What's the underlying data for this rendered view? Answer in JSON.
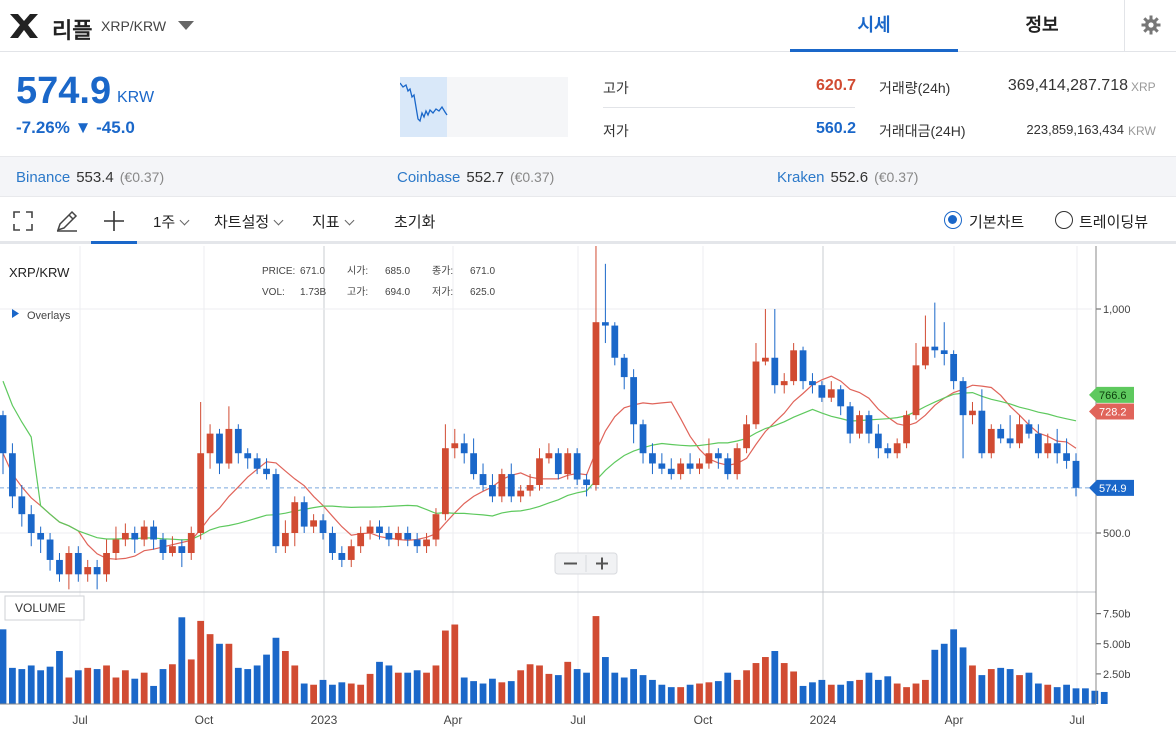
{
  "header": {
    "coin_name": "리플",
    "pair": "XRP/KRW",
    "tabs": [
      {
        "label": "시세",
        "active": true
      },
      {
        "label": "정보",
        "active": false
      }
    ]
  },
  "ticker": {
    "price": "574.9",
    "unit": "KRW",
    "change": "-7.26% ▼ -45.0",
    "high_label": "고가",
    "high_value": "620.7",
    "low_label": "저가",
    "low_value": "560.2",
    "volume_label": "거래량(24h)",
    "volume_value": "369,414,287.718",
    "volume_unit": "XRP",
    "amount_label": "거래대금(24H)",
    "amount_value": "223,859,163,434",
    "amount_unit": "KRW"
  },
  "exchanges": [
    {
      "name": "Binance",
      "price": "553.4",
      "eur": "(€0.37)"
    },
    {
      "name": "Coinbase",
      "price": "552.7",
      "eur": "(€0.37)"
    },
    {
      "name": "Kraken",
      "price": "552.6",
      "eur": "(€0.37)"
    }
  ],
  "toolbar": {
    "interval": "1주",
    "chart_settings": "차트설정",
    "indicators": "지표",
    "reset": "초기화",
    "basic_chart": "기본차트",
    "tradingview": "트레이딩뷰",
    "selected_mode": "basic"
  },
  "colors": {
    "up": "#d14b32",
    "down": "#1a67c9",
    "ma_green": "#5ec95e",
    "ma_red": "#e0645a",
    "accent": "#1a67c9"
  },
  "chart_data": {
    "type": "candlestick",
    "title": "XRP/KRW",
    "overlays_label": "Overlays",
    "volume_label": "VOLUME",
    "legend": {
      "PRICE": "671.0",
      "VOL": "1.73B",
      "시가": "685.0",
      "고가": "694.0",
      "종가": "671.0",
      "저가": "625.0"
    },
    "x_ticks": [
      "Jul",
      "Oct",
      "2023",
      "Apr",
      "Jul",
      "Oct",
      "2024",
      "Apr",
      "Jul"
    ],
    "y_ticks": [
      "1,000",
      "500.0"
    ],
    "y_scale": "log",
    "vol_ticks": [
      "7.50b",
      "5.00b",
      "2.50b"
    ],
    "markers": [
      {
        "label": "766.6",
        "value": 766.6,
        "color": "#5ec95e"
      },
      {
        "label": "728.2",
        "value": 728.2,
        "color": "#e0645a"
      },
      {
        "label": "574.9",
        "value": 574.9,
        "color": "#1a67c9"
      }
    ],
    "candles": [
      [
        720,
        640,
        730,
        600
      ],
      [
        640,
        560,
        660,
        540
      ],
      [
        560,
        530,
        580,
        510
      ],
      [
        530,
        500,
        545,
        480
      ],
      [
        500,
        490,
        510,
        470
      ],
      [
        490,
        460,
        500,
        445
      ],
      [
        460,
        440,
        470,
        430
      ],
      [
        440,
        470,
        480,
        420
      ],
      [
        470,
        440,
        480,
        430
      ],
      [
        440,
        450,
        460,
        430
      ],
      [
        450,
        440,
        460,
        420
      ],
      [
        440,
        470,
        490,
        430
      ],
      [
        470,
        490,
        510,
        460
      ],
      [
        490,
        500,
        515,
        480
      ],
      [
        500,
        490,
        510,
        470
      ],
      [
        490,
        510,
        520,
        480
      ],
      [
        510,
        490,
        520,
        475
      ],
      [
        490,
        470,
        500,
        460
      ],
      [
        470,
        480,
        495,
        465
      ],
      [
        480,
        470,
        490,
        450
      ],
      [
        470,
        500,
        510,
        460
      ],
      [
        500,
        640,
        750,
        490
      ],
      [
        640,
        680,
        700,
        610
      ],
      [
        680,
        620,
        690,
        600
      ],
      [
        620,
        690,
        740,
        610
      ],
      [
        690,
        640,
        700,
        620
      ],
      [
        640,
        630,
        650,
        610
      ],
      [
        630,
        610,
        640,
        600
      ],
      [
        610,
        600,
        630,
        590
      ],
      [
        600,
        480,
        610,
        470
      ],
      [
        480,
        500,
        520,
        470
      ],
      [
        500,
        550,
        560,
        480
      ],
      [
        550,
        510,
        560,
        500
      ],
      [
        510,
        520,
        530,
        500
      ],
      [
        520,
        500,
        530,
        490
      ],
      [
        500,
        470,
        510,
        460
      ],
      [
        470,
        460,
        480,
        450
      ],
      [
        460,
        480,
        490,
        450
      ],
      [
        480,
        500,
        510,
        470
      ],
      [
        500,
        510,
        520,
        490
      ],
      [
        510,
        500,
        520,
        490
      ],
      [
        500,
        490,
        510,
        480
      ],
      [
        490,
        500,
        510,
        480
      ],
      [
        500,
        490,
        510,
        480
      ],
      [
        490,
        480,
        500,
        470
      ],
      [
        480,
        490,
        500,
        470
      ],
      [
        490,
        530,
        540,
        480
      ],
      [
        530,
        650,
        700,
        520
      ],
      [
        650,
        660,
        690,
        630
      ],
      [
        660,
        640,
        680,
        620
      ],
      [
        640,
        600,
        670,
        590
      ],
      [
        600,
        580,
        620,
        570
      ],
      [
        580,
        560,
        600,
        550
      ],
      [
        560,
        600,
        610,
        550
      ],
      [
        600,
        560,
        620,
        550
      ],
      [
        560,
        570,
        580,
        550
      ],
      [
        570,
        580,
        600,
        560
      ],
      [
        580,
        630,
        650,
        570
      ],
      [
        630,
        640,
        660,
        620
      ],
      [
        640,
        600,
        650,
        590
      ],
      [
        600,
        640,
        650,
        590
      ],
      [
        640,
        590,
        650,
        580
      ],
      [
        590,
        580,
        600,
        560
      ],
      [
        580,
        960,
        1250,
        570
      ],
      [
        960,
        950,
        1150,
        900
      ],
      [
        950,
        860,
        960,
        840
      ],
      [
        860,
        810,
        870,
        780
      ],
      [
        810,
        700,
        830,
        660
      ],
      [
        700,
        640,
        710,
        620
      ],
      [
        640,
        620,
        660,
        600
      ],
      [
        620,
        610,
        640,
        600
      ],
      [
        610,
        600,
        630,
        590
      ],
      [
        600,
        620,
        630,
        590
      ],
      [
        620,
        610,
        640,
        600
      ],
      [
        610,
        620,
        630,
        600
      ],
      [
        620,
        640,
        670,
        610
      ],
      [
        640,
        630,
        650,
        610
      ],
      [
        630,
        600,
        640,
        590
      ],
      [
        600,
        650,
        660,
        590
      ],
      [
        650,
        700,
        720,
        640
      ],
      [
        700,
        850,
        900,
        690
      ],
      [
        850,
        860,
        1000,
        840
      ],
      [
        860,
        790,
        1000,
        770
      ],
      [
        790,
        800,
        820,
        770
      ],
      [
        800,
        880,
        900,
        790
      ],
      [
        880,
        800,
        890,
        780
      ],
      [
        800,
        790,
        820,
        770
      ],
      [
        790,
        760,
        800,
        750
      ],
      [
        760,
        780,
        800,
        750
      ],
      [
        780,
        740,
        790,
        720
      ],
      [
        740,
        680,
        750,
        660
      ],
      [
        680,
        720,
        730,
        670
      ],
      [
        720,
        680,
        730,
        660
      ],
      [
        680,
        650,
        700,
        630
      ],
      [
        650,
        640,
        660,
        630
      ],
      [
        640,
        660,
        670,
        630
      ],
      [
        660,
        720,
        730,
        650
      ],
      [
        720,
        840,
        900,
        710
      ],
      [
        840,
        890,
        980,
        830
      ],
      [
        890,
        880,
        1020,
        860
      ],
      [
        880,
        870,
        960,
        840
      ],
      [
        870,
        800,
        880,
        780
      ],
      [
        800,
        720,
        810,
        630
      ],
      [
        720,
        730,
        750,
        700
      ],
      [
        730,
        640,
        780,
        630
      ],
      [
        640,
        690,
        700,
        630
      ],
      [
        690,
        670,
        700,
        660
      ],
      [
        670,
        660,
        720,
        650
      ],
      [
        660,
        700,
        720,
        650
      ],
      [
        700,
        680,
        710,
        670
      ],
      [
        680,
        640,
        700,
        630
      ],
      [
        640,
        660,
        680,
        630
      ],
      [
        660,
        640,
        690,
        620
      ],
      [
        640,
        625,
        670,
        610
      ],
      [
        625,
        575,
        640,
        560
      ]
    ],
    "volumes": [
      6.2,
      3.0,
      2.9,
      3.2,
      2.8,
      3.1,
      4.4,
      2.2,
      2.8,
      3.0,
      2.9,
      3.2,
      2.2,
      2.8,
      2.1,
      2.6,
      1.5,
      2.9,
      3.3,
      7.2,
      3.7,
      6.9,
      5.8,
      5.0,
      5.0,
      3.0,
      2.9,
      3.2,
      4.1,
      5.5,
      4.4,
      3.2,
      1.7,
      1.6,
      2.0,
      1.6,
      1.8,
      1.7,
      1.6,
      2.5,
      3.5,
      3.2,
      2.6,
      2.6,
      2.8,
      2.6,
      3.2,
      6.1,
      6.6,
      2.2,
      1.9,
      1.7,
      2.1,
      1.8,
      1.9,
      2.8,
      3.3,
      3.2,
      2.5,
      2.4,
      3.5,
      2.9,
      2.6,
      7.3,
      3.9,
      2.6,
      2.2,
      2.9,
      2.4,
      2.0,
      1.6,
      1.4,
      1.4,
      1.6,
      1.7,
      1.8,
      1.9,
      2.6,
      2.0,
      2.8,
      3.4,
      3.9,
      4.4,
      3.4,
      2.7,
      1.5,
      1.8,
      2.0,
      1.6,
      1.6,
      1.9,
      2.0,
      2.6,
      2.0,
      2.3,
      1.7,
      1.4,
      1.7,
      2.0,
      4.5,
      5.0,
      6.2,
      4.7,
      3.2,
      2.4,
      2.9,
      3.0,
      2.9,
      2.4,
      2.6,
      1.7,
      1.6,
      1.4,
      1.6,
      1.3,
      1.3,
      1.1,
      1.0
    ]
  }
}
